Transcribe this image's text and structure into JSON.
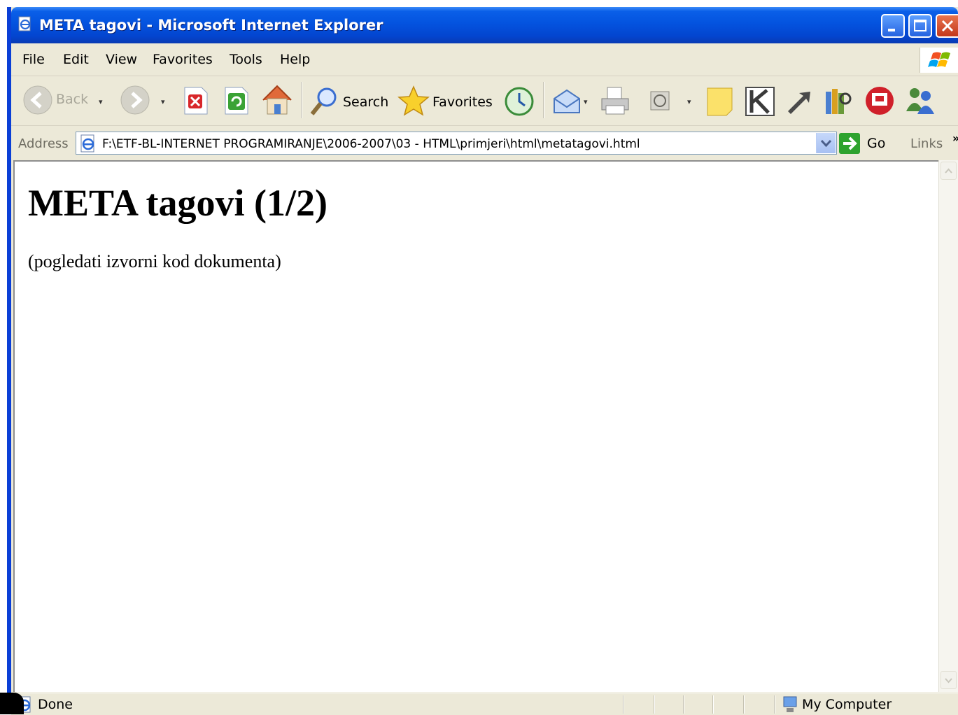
{
  "window": {
    "title": "META tagovi - Microsoft Internet Explorer"
  },
  "menubar": {
    "items": [
      "File",
      "Edit",
      "View",
      "Favorites",
      "Tools",
      "Help"
    ]
  },
  "toolbar": {
    "back_label": "Back",
    "search_label": "Search",
    "favorites_label": "Favorites"
  },
  "address": {
    "label": "Address",
    "url": "F:\\ETF-BL-INTERNET PROGRAMIRANJE\\2006-2007\\03 - HTML\\primjeri\\html\\metatagovi.html",
    "go_label": "Go",
    "links_label": "Links",
    "chevron": "»"
  },
  "page": {
    "heading": "META tagovi (1/2)",
    "paragraph": "(pogledati izvorni kod dokumenta)"
  },
  "status": {
    "text": "Done",
    "zone": "My Computer"
  },
  "colors": {
    "titlebar": "#0453df",
    "chrome": "#ece9d8"
  }
}
